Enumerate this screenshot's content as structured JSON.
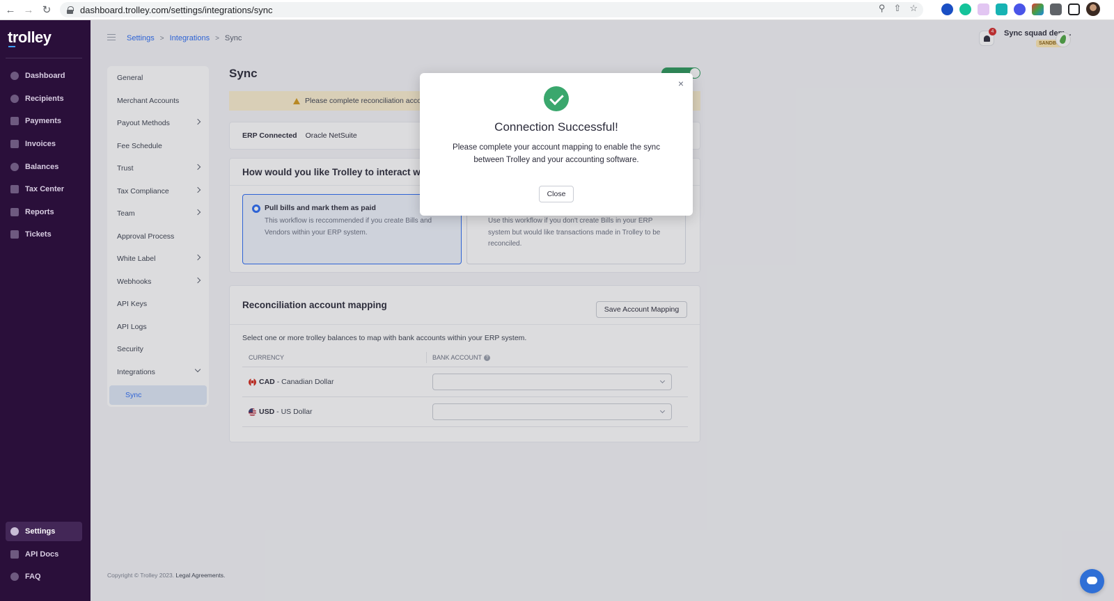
{
  "browser": {
    "url": "dashboard.trolley.com/settings/integrations/sync"
  },
  "brand": {
    "name": "trolley"
  },
  "sidenav": {
    "items": [
      {
        "label": "Dashboard",
        "icon": "dashboard-icon"
      },
      {
        "label": "Recipients",
        "icon": "recipients-icon"
      },
      {
        "label": "Payments",
        "icon": "payments-icon"
      },
      {
        "label": "Invoices",
        "icon": "invoices-icon"
      },
      {
        "label": "Balances",
        "icon": "balances-icon"
      },
      {
        "label": "Tax Center",
        "icon": "tax-center-icon"
      },
      {
        "label": "Reports",
        "icon": "reports-icon"
      },
      {
        "label": "Tickets",
        "icon": "tickets-icon"
      }
    ],
    "bottom": [
      {
        "label": "Settings",
        "icon": "gear-icon",
        "active": true
      },
      {
        "label": "API Docs",
        "icon": "api-docs-icon"
      },
      {
        "label": "FAQ",
        "icon": "faq-icon"
      }
    ]
  },
  "header": {
    "breadcrumb": [
      "Settings",
      "Integrations",
      "Sync"
    ],
    "notification_count": "4",
    "account_name": "Sync squad dem...",
    "environment_badge": "SANDBOX"
  },
  "settings_menu": {
    "items": [
      {
        "label": "General",
        "chevron": false
      },
      {
        "label": "Merchant Accounts",
        "chevron": false
      },
      {
        "label": "Payout Methods",
        "chevron": true
      },
      {
        "label": "Fee Schedule",
        "chevron": false
      },
      {
        "label": "Trust",
        "chevron": true
      },
      {
        "label": "Tax Compliance",
        "chevron": true
      },
      {
        "label": "Team",
        "chevron": true
      },
      {
        "label": "Approval Process",
        "chevron": false
      },
      {
        "label": "White Label",
        "chevron": true
      },
      {
        "label": "Webhooks",
        "chevron": true
      },
      {
        "label": "API Keys",
        "chevron": false
      },
      {
        "label": "API Logs",
        "chevron": false
      },
      {
        "label": "Security",
        "chevron": false
      },
      {
        "label": "Integrations",
        "chevron": "down"
      }
    ],
    "sub_item": "Sync"
  },
  "page": {
    "title": "Sync",
    "alert_text": "Please complete reconciliation acco",
    "erp": {
      "label": "ERP Connected",
      "value": "Oracle NetSuite"
    },
    "interact_heading": "How would you like Trolley to interact with",
    "options": [
      {
        "title": "Pull bills and mark them as paid",
        "description": "This workflow is reccommended if you create Bills and Vendors within your ERP system.",
        "selected": true
      },
      {
        "title": "",
        "description": "Use this workflow if you don't create Bills in your ERP system but would like transactions made in Trolley to be reconciled.",
        "selected": false
      }
    ],
    "recon": {
      "heading": "Reconciliation account mapping",
      "save_label": "Save Account Mapping",
      "description": "Select one or more trolley balances to map with bank accounts within your ERP system.",
      "columns": [
        "CURRENCY",
        "BANK ACCOUNT"
      ],
      "rows": [
        {
          "code": "CAD",
          "name": "- Canadian Dollar",
          "flag": "canada-flag-icon",
          "bank_account": ""
        },
        {
          "code": "USD",
          "name": "- US Dollar",
          "flag": "us-flag-icon",
          "bank_account": ""
        }
      ]
    }
  },
  "footer": {
    "copyright": "Copyright © Trolley 2023.",
    "legal": "Legal Agreements."
  },
  "modal": {
    "title": "Connection Successful!",
    "message": "Please complete your account mapping to enable the sync between Trolley and your accounting software.",
    "close_label": "Close",
    "success_color": "#3aa76d"
  },
  "colors": {
    "sidebar": "#2a0f3a",
    "accent": "#2b6cf5",
    "toggle_on": "#2e9b5e"
  }
}
